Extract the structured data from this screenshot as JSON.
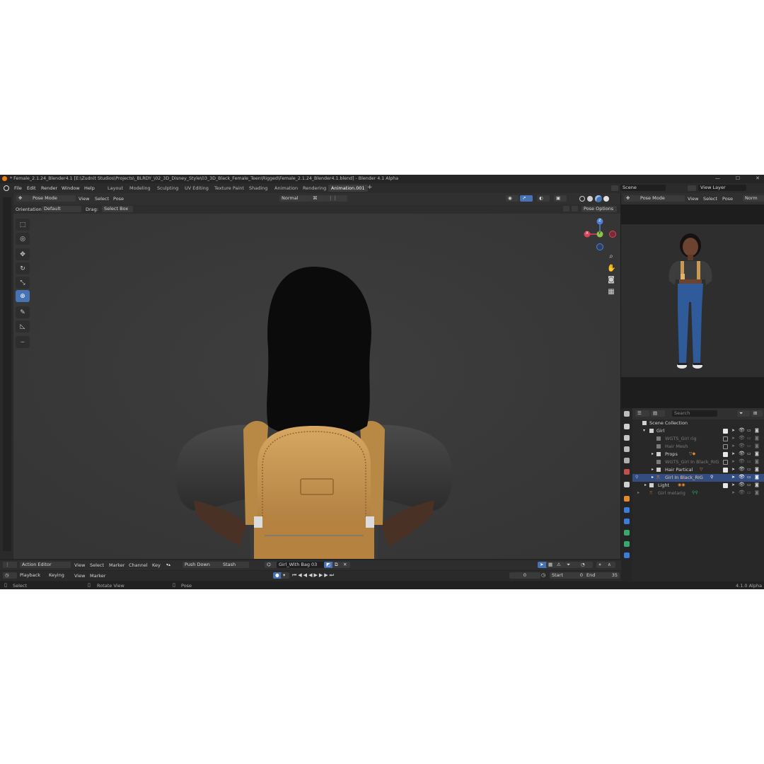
{
  "window": {
    "title": "* Female_2.1.24_Blender4.1 [E:\\Zudnit Studios\\Projects\\_BLRDY_\\02_3D_Disney_Style\\03_3D_Black_Female_Teen\\Rigged\\Female_2.1.24_Blender4.1.blend] - Blender 4.1 Alpha",
    "minimize": "—",
    "maximize": "☐",
    "close": "✕"
  },
  "menu": [
    "File",
    "Edit",
    "Render",
    "Window",
    "Help"
  ],
  "workspaces": [
    "Layout",
    "Modeling",
    "Sculpting",
    "UV Editing",
    "Texture Paint",
    "Shading",
    "Animation",
    "Rendering",
    "Animation.001"
  ],
  "workspace_add": "+",
  "scene": {
    "label": "Scene",
    "view_layer": "View Layer"
  },
  "viewport_header": {
    "mode": "Pose Mode",
    "view": "View",
    "select": "Select",
    "pose": "Pose",
    "transform_orientation": "Normal",
    "orientation_label": "Orientation:",
    "orientation_value": "Default",
    "drag_label": "Drag:",
    "drag_value": "Select Box",
    "pose_options": "Pose Options"
  },
  "gizmo": {
    "z": "Z",
    "x": "X",
    "y": "Y"
  },
  "preview_header": {
    "mode": "Pose Mode",
    "view": "View",
    "select": "Select",
    "pose": "Pose",
    "shading": "Norm"
  },
  "outliner": {
    "search_placeholder": "Search",
    "rows": [
      {
        "name": "Scene Collection",
        "indent": 0,
        "dim": false,
        "selected": false,
        "check": "none"
      },
      {
        "name": "Girl",
        "indent": 1,
        "dim": false,
        "selected": false,
        "check": "on"
      },
      {
        "name": "WGTS_Girl rig",
        "indent": 2,
        "dim": true,
        "selected": false,
        "check": "off"
      },
      {
        "name": "Hair Mesh",
        "indent": 2,
        "dim": true,
        "selected": false,
        "check": "off"
      },
      {
        "name": "Props",
        "indent": 2,
        "dim": false,
        "selected": false,
        "check": "on"
      },
      {
        "name": "WGTS_Girl In Black_RIG",
        "indent": 2,
        "dim": true,
        "selected": false,
        "check": "off"
      },
      {
        "name": "Hair Partical",
        "indent": 2,
        "dim": false,
        "selected": false,
        "check": "on"
      },
      {
        "name": "Girl In Black_RIG",
        "indent": 2,
        "dim": false,
        "selected": true,
        "check": "none"
      },
      {
        "name": "Light",
        "indent": 1,
        "dim": false,
        "selected": false,
        "check": "on"
      },
      {
        "name": "Girl metarig",
        "indent": 1,
        "dim": true,
        "selected": false,
        "check": "none"
      }
    ]
  },
  "action_editor": {
    "mode": "Action Editor",
    "view": "View",
    "select": "Select",
    "marker": "Marker",
    "channel": "Channel",
    "key": "Key",
    "push_down": "Push Down",
    "stash": "Stash",
    "action_name": "Girl_With Bag 03"
  },
  "timeline": {
    "playback": "Playback",
    "keying": "Keying",
    "view": "View",
    "marker": "Marker",
    "current_frame": "0",
    "start_label": "Start",
    "start": "0",
    "end_label": "End",
    "end": "35"
  },
  "status": {
    "select": "Select",
    "rotate": "Rotate View",
    "pose": "Pose",
    "version": "4.1.0 Alpha"
  },
  "colors": {
    "accent": "#4772b3",
    "viewport_bg": "#393939",
    "backpack": "#c99a52",
    "shirt": "#3d3d3d",
    "hair": "#0b0b0b",
    "jeans": "#2f5b9a"
  }
}
